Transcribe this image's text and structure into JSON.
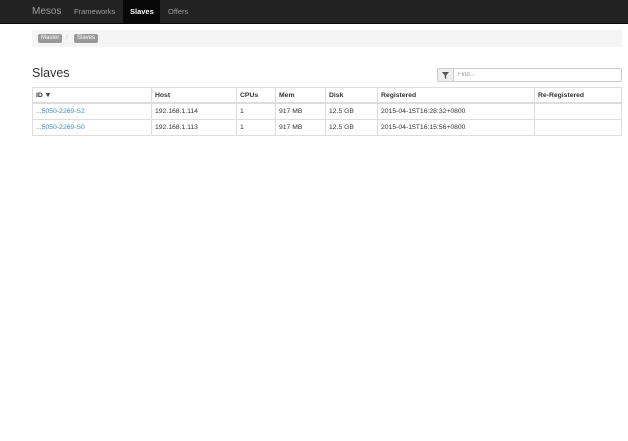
{
  "navbar": {
    "brand": "Mesos",
    "links": [
      {
        "label": "Frameworks",
        "active": false
      },
      {
        "label": "Slaves",
        "active": true
      },
      {
        "label": "Offers",
        "active": false
      }
    ]
  },
  "breadcrumb": [
    "Master",
    "Slaves"
  ],
  "page_title": "Slaves",
  "filter": {
    "placeholder": "Find...",
    "icon": "filter-icon"
  },
  "table": {
    "columns": [
      "ID ▼",
      "Host",
      "CPUs",
      "Mem",
      "Disk",
      "Registered",
      "Re-Registered"
    ],
    "rows": [
      {
        "id": "...5050-2269-S2",
        "host": "192.168.1.114",
        "cpus": "1",
        "mem": "917 MB",
        "disk": "12.5 GB",
        "registered": "2015-04-15T16:28:32+0800",
        "reregistered": ""
      },
      {
        "id": "...5050-2269-S0",
        "host": "192.168.1.113",
        "cpus": "1",
        "mem": "917 MB",
        "disk": "12.5 GB",
        "registered": "2015-04-15T16:15:56+0800",
        "reregistered": ""
      }
    ]
  }
}
